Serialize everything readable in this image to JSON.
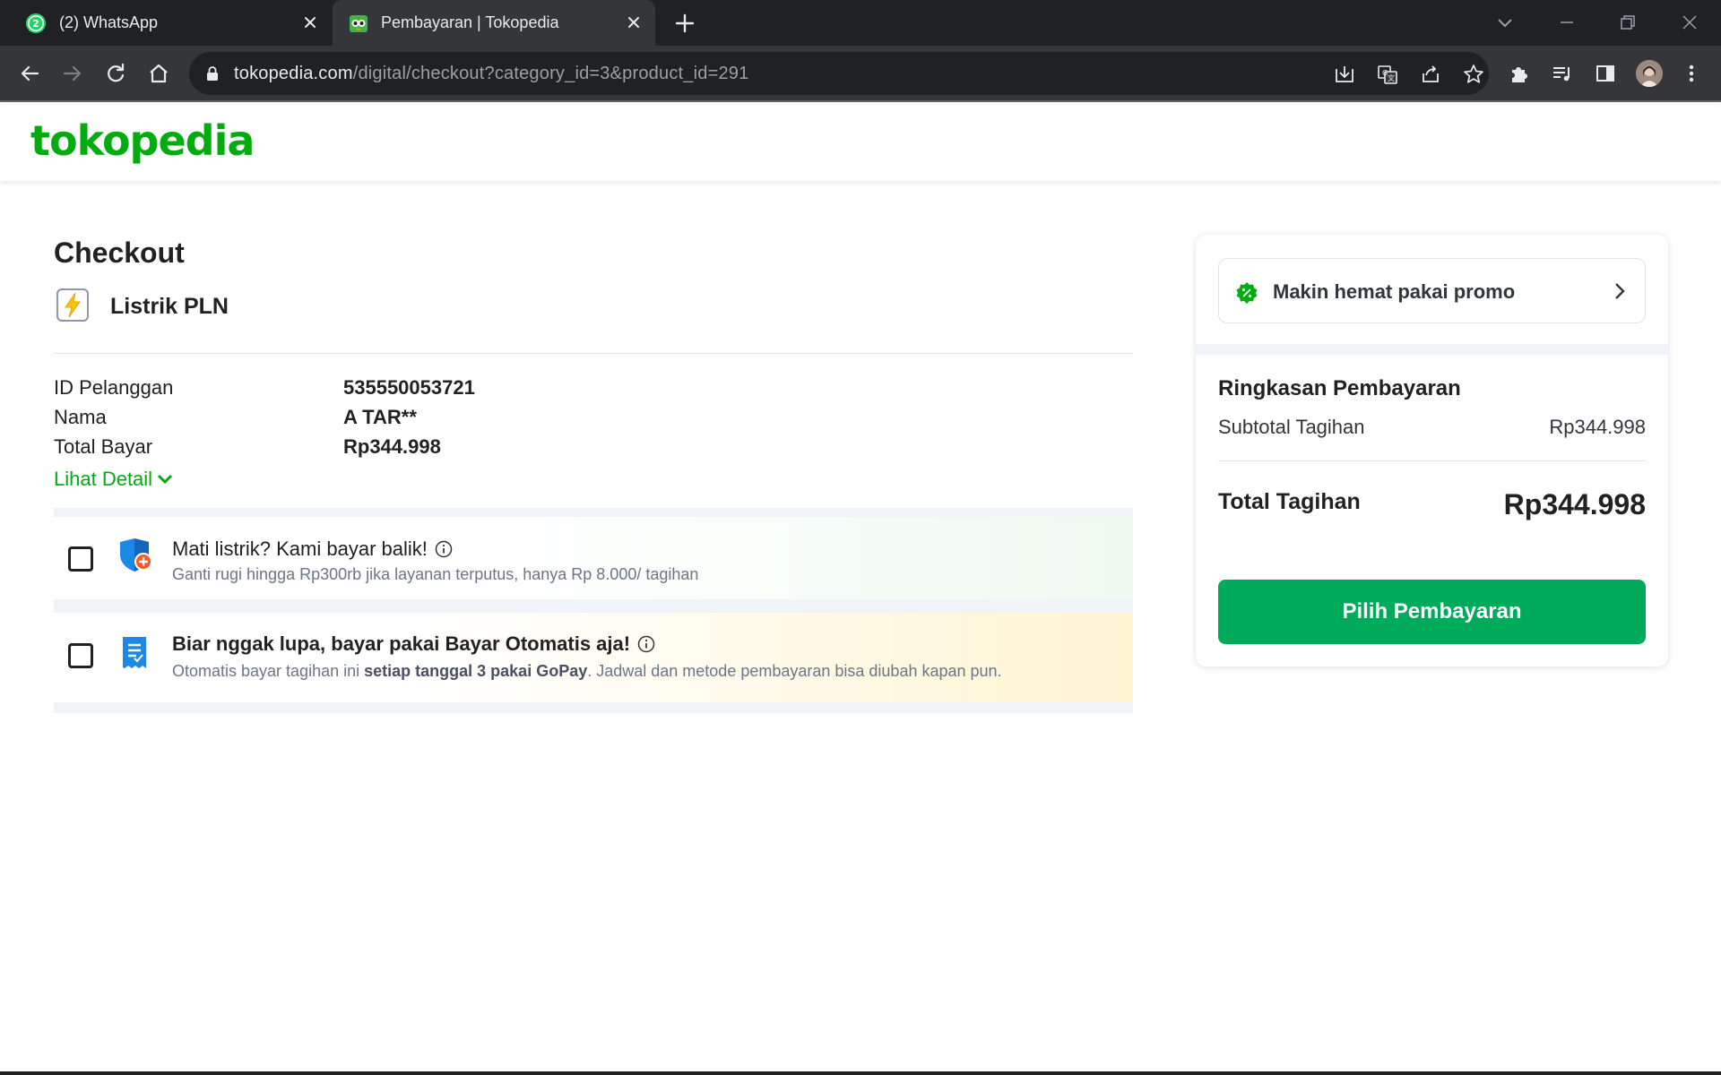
{
  "browser": {
    "tabs": [
      {
        "title": "(2) WhatsApp",
        "badge": "2",
        "active": false
      },
      {
        "title": "Pembayaran | Tokopedia",
        "active": true
      }
    ],
    "url_host": "tokopedia.com",
    "url_path": "/digital/checkout?category_id=3&product_id=291"
  },
  "header": {
    "logo": "tokopedia"
  },
  "checkout": {
    "title": "Checkout",
    "product": "Listrik PLN",
    "rows": [
      {
        "label": "ID Pelanggan",
        "value": "535550053721"
      },
      {
        "label": "Nama",
        "value": "A TAR**"
      },
      {
        "label": "Total Bayar",
        "value": "Rp344.998"
      }
    ],
    "detail_link": "Lihat Detail"
  },
  "options": {
    "protection": {
      "title": "Mati listrik? Kami bayar balik!",
      "subtitle": "Ganti rugi hingga Rp300rb jika layanan terputus, hanya Rp 8.000/ tagihan",
      "checked": false
    },
    "autopay": {
      "title": "Biar nggak lupa, bayar pakai Bayar Otomatis aja!",
      "sub_prefix": "Otomatis bayar tagihan ini ",
      "sub_bold": "setiap tanggal 3 pakai GoPay",
      "sub_suffix": ". Jadwal dan metode pembayaran bisa diubah kapan pun.",
      "checked": false
    }
  },
  "summary": {
    "promo": "Makin hemat pakai promo",
    "title": "Ringkasan Pembayaran",
    "subtotal_label": "Subtotal Tagihan",
    "subtotal_value": "Rp344.998",
    "total_label": "Total Tagihan",
    "total_value": "Rp344.998",
    "pay_button": "Pilih Pembayaran"
  },
  "colors": {
    "brand_green": "#03ac0e",
    "button_green": "#00aa5b",
    "chrome_dark": "#202124",
    "chrome_toolbar": "#35363a"
  }
}
